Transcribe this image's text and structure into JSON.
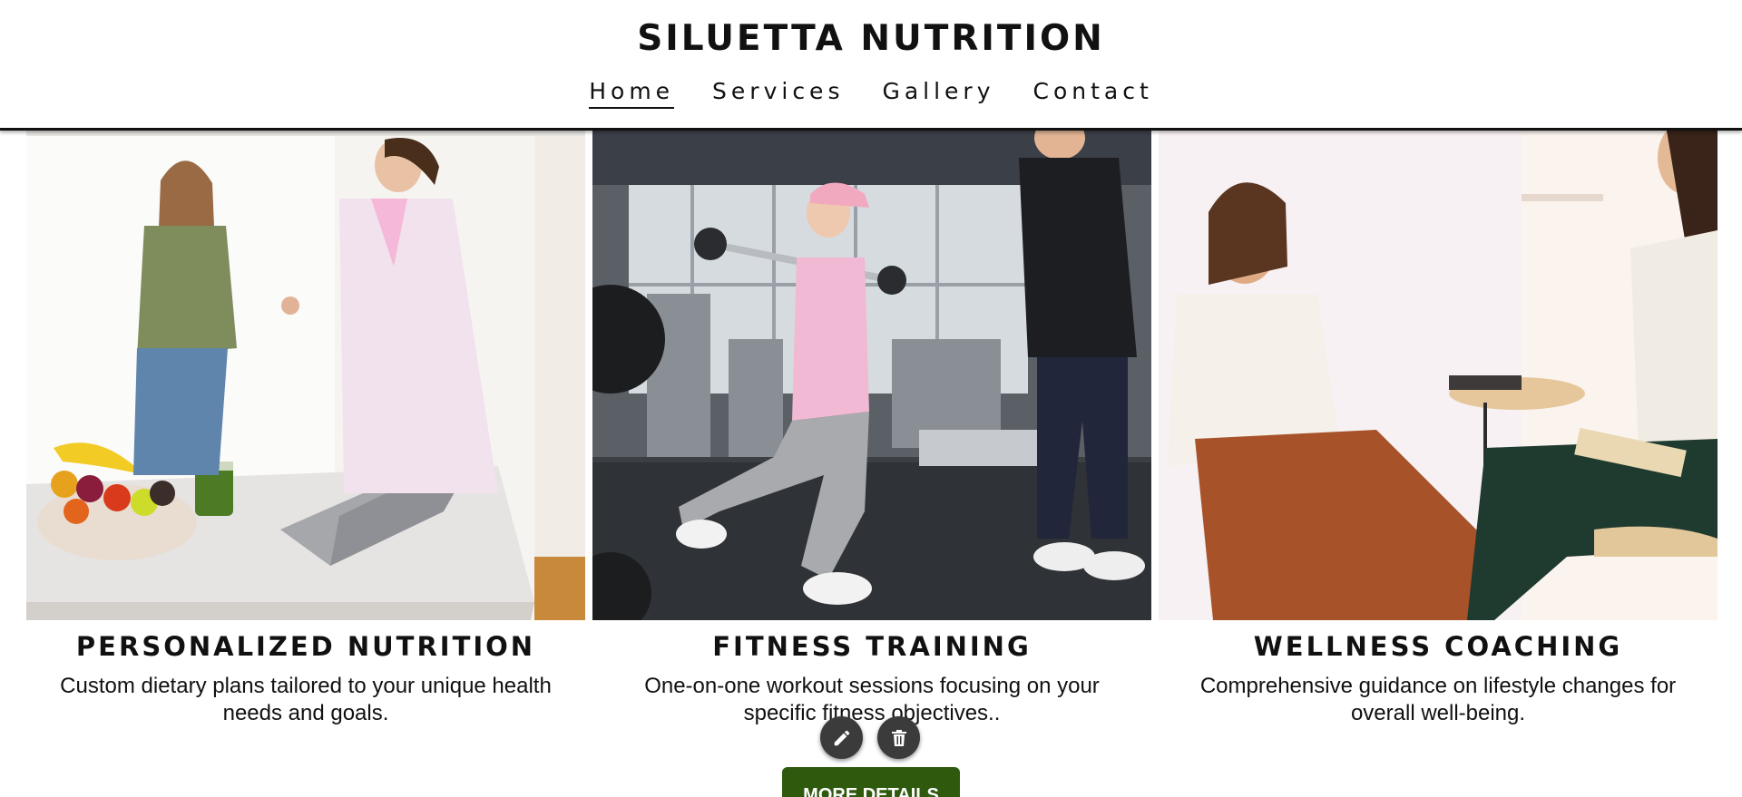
{
  "brand": {
    "title": "SILUETTA NUTRITION"
  },
  "nav": {
    "items": [
      {
        "label": "Home",
        "active": true
      },
      {
        "label": "Services",
        "active": false
      },
      {
        "label": "Gallery",
        "active": false
      },
      {
        "label": "Contact",
        "active": false
      }
    ]
  },
  "services": [
    {
      "title": "PERSONALIZED NUTRITION",
      "description": "Custom dietary plans tailored to your unique health needs and goals.",
      "image": "nutritionist-consultation-photo"
    },
    {
      "title": "FITNESS TRAINING",
      "description": "One-on-one workout sessions focusing on your specific fitness objectives..",
      "image": "gym-training-photo"
    },
    {
      "title": "WELLNESS COACHING",
      "description": "Comprehensive guidance on lifestyle changes for overall well-being.",
      "image": "coaching-session-photo"
    }
  ],
  "tools": {
    "edit_icon": "pencil-icon",
    "delete_icon": "trash-icon"
  },
  "cta": {
    "label": "MORE DETAILS",
    "color": "#2f5a0e"
  }
}
